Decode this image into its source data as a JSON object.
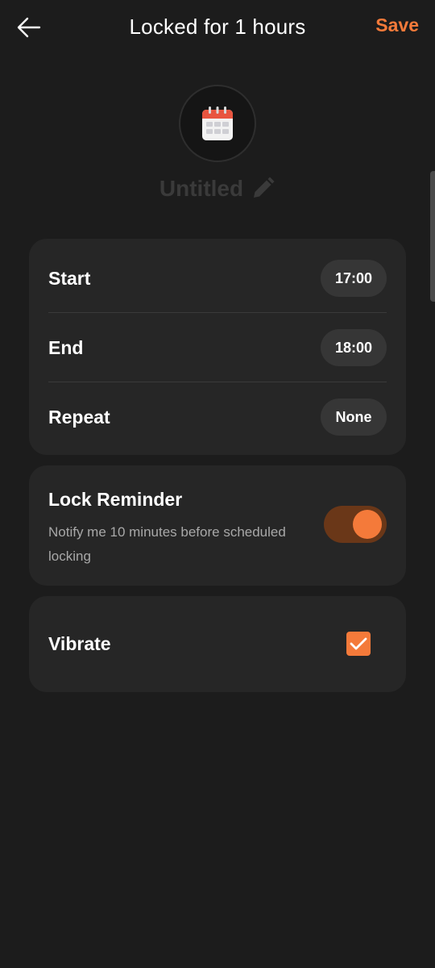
{
  "header": {
    "title": "Locked for 1 hours",
    "save_label": "Save"
  },
  "schedule": {
    "name": "Untitled",
    "icon": "calendar-icon"
  },
  "time_settings": {
    "start_label": "Start",
    "start_value": "17:00",
    "end_label": "End",
    "end_value": "18:00",
    "repeat_label": "Repeat",
    "repeat_value": "None"
  },
  "reminder": {
    "title": "Lock Reminder",
    "description": "Notify me 10 minutes before scheduled locking",
    "enabled": true
  },
  "vibrate": {
    "label": "Vibrate",
    "checked": true
  },
  "colors": {
    "accent": "#f47a3a",
    "background": "#1c1c1c",
    "card": "#262626"
  }
}
